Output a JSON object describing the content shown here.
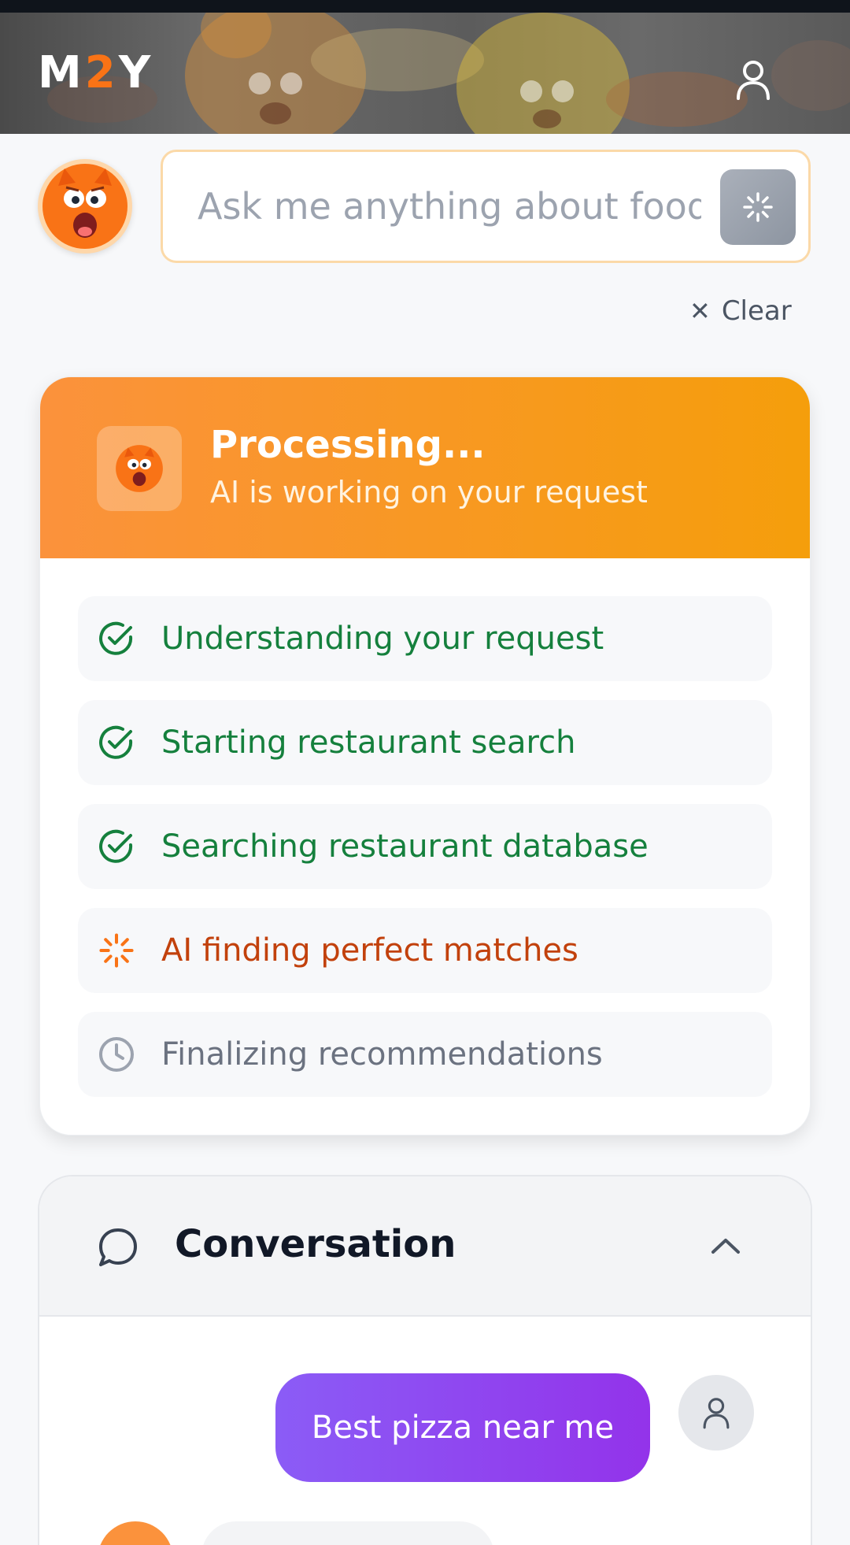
{
  "header": {
    "logo": {
      "left": "M",
      "accent": "2",
      "right": "Y"
    },
    "profile_icon": "user-outline-icon"
  },
  "search": {
    "placeholder": "Ask me anything about food",
    "send_icon": "loading-spinner-icon",
    "clear_label": "Clear",
    "clear_icon": "close-icon"
  },
  "processing": {
    "title": "Processing...",
    "subtitle": "AI is working on your request",
    "steps": [
      {
        "label": "Understanding your request",
        "status": "done",
        "icon": "check-circle-icon"
      },
      {
        "label": "Starting restaurant search",
        "status": "done",
        "icon": "check-circle-icon"
      },
      {
        "label": "Searching restaurant database",
        "status": "done",
        "icon": "check-circle-icon"
      },
      {
        "label": "AI finding perfect matches",
        "status": "active",
        "icon": "loading-spinner-icon"
      },
      {
        "label": "Finalizing recommendations",
        "status": "pending",
        "icon": "clock-icon"
      }
    ]
  },
  "conversation": {
    "title": "Conversation",
    "icon": "chat-bubble-icon",
    "collapse_icon": "chevron-up-icon",
    "messages": [
      {
        "role": "user",
        "text": "Best pizza near me"
      }
    ]
  },
  "colors": {
    "accent": "#f97316",
    "processing_gradient_start": "#fb923c",
    "processing_gradient_end": "#f59e0b",
    "done": "#15803d",
    "active": "#c2410c",
    "pending": "#6b7280",
    "user_bubble": "#8b5cf6"
  }
}
